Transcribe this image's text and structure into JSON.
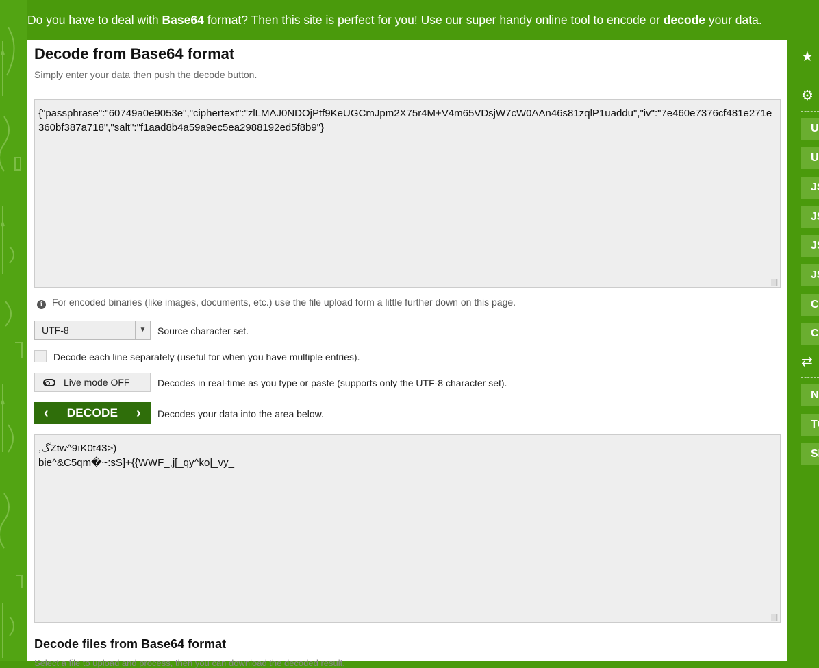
{
  "banner": {
    "t1": "Do you have to deal with ",
    "b1": "Base64",
    "t2": " format? Then this site is perfect for you! Use our super handy online tool to encode or ",
    "b2": "decode",
    "t3": " your data."
  },
  "main": {
    "title": "Decode from Base64 format",
    "subtitle": "Simply enter your data then push the decode button.",
    "input_value": "{\"passphrase\":\"60749a0e9053e\",\"ciphertext\":\"zlLMAJ0NDOjPtf9KeUGCmJpm2X75r4M+V4m65VDsjW7cW0AAn46s81zqlP1uaddu\",\"iv\":\"7e460e7376cf481e271e360bf387a718\",\"salt\":\"f1aad8b4a59a9ec5ea2988192ed5f8b9\"}",
    "info_text": "For encoded binaries (like images, documents, etc.) use the file upload form a little further down on this page.",
    "charset_value": "UTF-8",
    "charset_label": "Source character set.",
    "line_by_line_label": "Decode each line separately (useful for when you have multiple entries).",
    "live_mode_label": "Live mode OFF",
    "live_mode_desc": "Decodes in real-time as you type or paste (supports only the UTF-8 character set).",
    "decode_label": "DECODE",
    "decode_desc": "Decodes your data into the area below.",
    "output_value": ",ﮒZtw^9ıK0t43>)\nbie^&C5qm�~:sS]+{{WWF_,j[_qy^ko|_vy_",
    "files_title": "Decode files from Base64 format",
    "files_subtitle": "Select a file to upload and process, then you can download the decoded result."
  },
  "sidebar": {
    "items": [
      {
        "label": "URL"
      },
      {
        "label": "URL"
      },
      {
        "label": "JS"
      },
      {
        "label": "JS"
      },
      {
        "label": "JS"
      },
      {
        "label": "JS"
      },
      {
        "label": "CS"
      },
      {
        "label": "CS"
      },
      {
        "label": "NE"
      },
      {
        "label": "TO"
      },
      {
        "label": "SI"
      }
    ]
  }
}
